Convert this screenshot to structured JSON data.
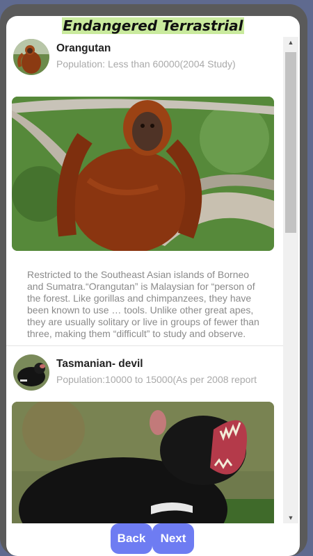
{
  "title": "Endangered Terrastrial",
  "animals": [
    {
      "name": "Orangutan",
      "population": "Population: Less than 60000(2004 Study)",
      "description": "Restricted to the Southeast Asian islands of Borneo and Sumatra.“Orangutan” is Malaysian for “person of the forest. Like gorillas and chimpanzees, they have been known to use … tools. Unlike other great apes, they are usually solitary or live in groups of fewer than three, making them “difficult” to study and observe."
    },
    {
      "name": "Tasmanian- devil",
      "population": "Population:10000 to 15000(As per 2008 report"
    }
  ],
  "buttons": {
    "back": "Back",
    "next": "Next"
  },
  "colors": {
    "accent": "#6e7cf2",
    "title_highlight": "#c9ea9d"
  }
}
